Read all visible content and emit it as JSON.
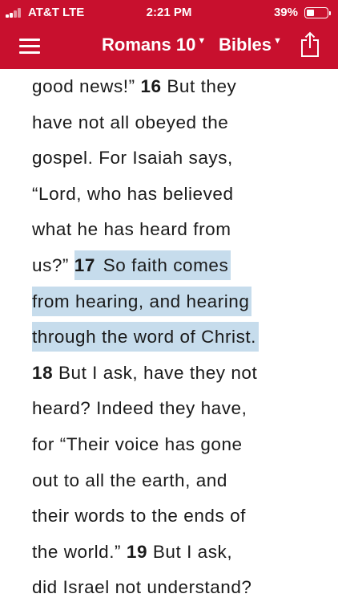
{
  "status_bar": {
    "carrier": "AT&T  LTE",
    "time": "2:21 PM",
    "battery_percent_label": "39%",
    "battery_level": 0.39
  },
  "nav": {
    "book_chapter": "Romans 10",
    "bible_selector": "Bibles",
    "icons": [
      "menu-icon",
      "share-icon",
      "caret-down-icon"
    ]
  },
  "theme": {
    "bar_color": "#c8102e",
    "highlight_color": "#c6dcec",
    "text_color": "#1a1a1a"
  },
  "passage": {
    "lines": [
      {
        "segments": [
          {
            "text": "good news!” "
          },
          {
            "text": "16",
            "verse": true
          },
          {
            "text": " But they"
          }
        ]
      },
      {
        "segments": [
          {
            "text": "have not all obeyed the"
          }
        ]
      },
      {
        "segments": [
          {
            "text": "gospel. For Isaiah says,"
          }
        ]
      },
      {
        "segments": [
          {
            "text": "“Lord, who has believed"
          }
        ]
      },
      {
        "segments": [
          {
            "text": "what he has heard from"
          }
        ]
      },
      {
        "segments": [
          {
            "text": "us?” "
          },
          {
            "text": "17",
            "verse": true,
            "highlight": true
          },
          {
            "text": " So faith comes",
            "highlight": true
          }
        ]
      },
      {
        "segments": [
          {
            "text": "from hearing, and hearing",
            "highlight": true
          }
        ]
      },
      {
        "segments": [
          {
            "text": "through the word of Christ.",
            "highlight": true
          }
        ]
      },
      {
        "segments": [
          {
            "text": "18",
            "verse": true
          },
          {
            "text": " But I ask, have they not"
          }
        ]
      },
      {
        "segments": [
          {
            "text": "heard? Indeed they have,"
          }
        ]
      },
      {
        "segments": [
          {
            "text": "for “Their voice has gone"
          }
        ]
      },
      {
        "segments": [
          {
            "text": "out to all the earth, and"
          }
        ]
      },
      {
        "segments": [
          {
            "text": "their words to the ends of"
          }
        ]
      },
      {
        "segments": [
          {
            "text": "the world.” "
          },
          {
            "text": "19",
            "verse": true
          },
          {
            "text": " But I ask,"
          }
        ]
      },
      {
        "segments": [
          {
            "text": "did Israel not understand?"
          }
        ]
      }
    ]
  }
}
